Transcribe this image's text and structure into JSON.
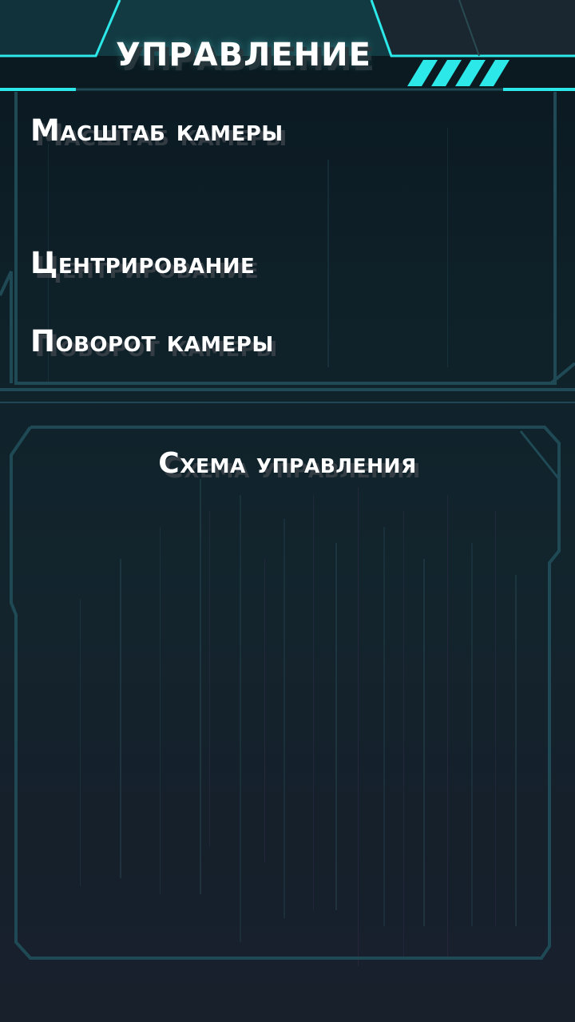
{
  "header": {
    "title": "УПРАВЛЕНИЕ"
  },
  "camera_settings": [
    {
      "key": "zoom",
      "label": "Масштаб камеры"
    },
    {
      "key": "center",
      "label": "Центрирование"
    },
    {
      "key": "rotate",
      "label": "Поворот камеры"
    }
  ],
  "control_scheme": {
    "title": "Схема управления"
  },
  "colors": {
    "accent": "#2de8e8",
    "frame": "#1f4a55",
    "background": "#0f222a"
  }
}
